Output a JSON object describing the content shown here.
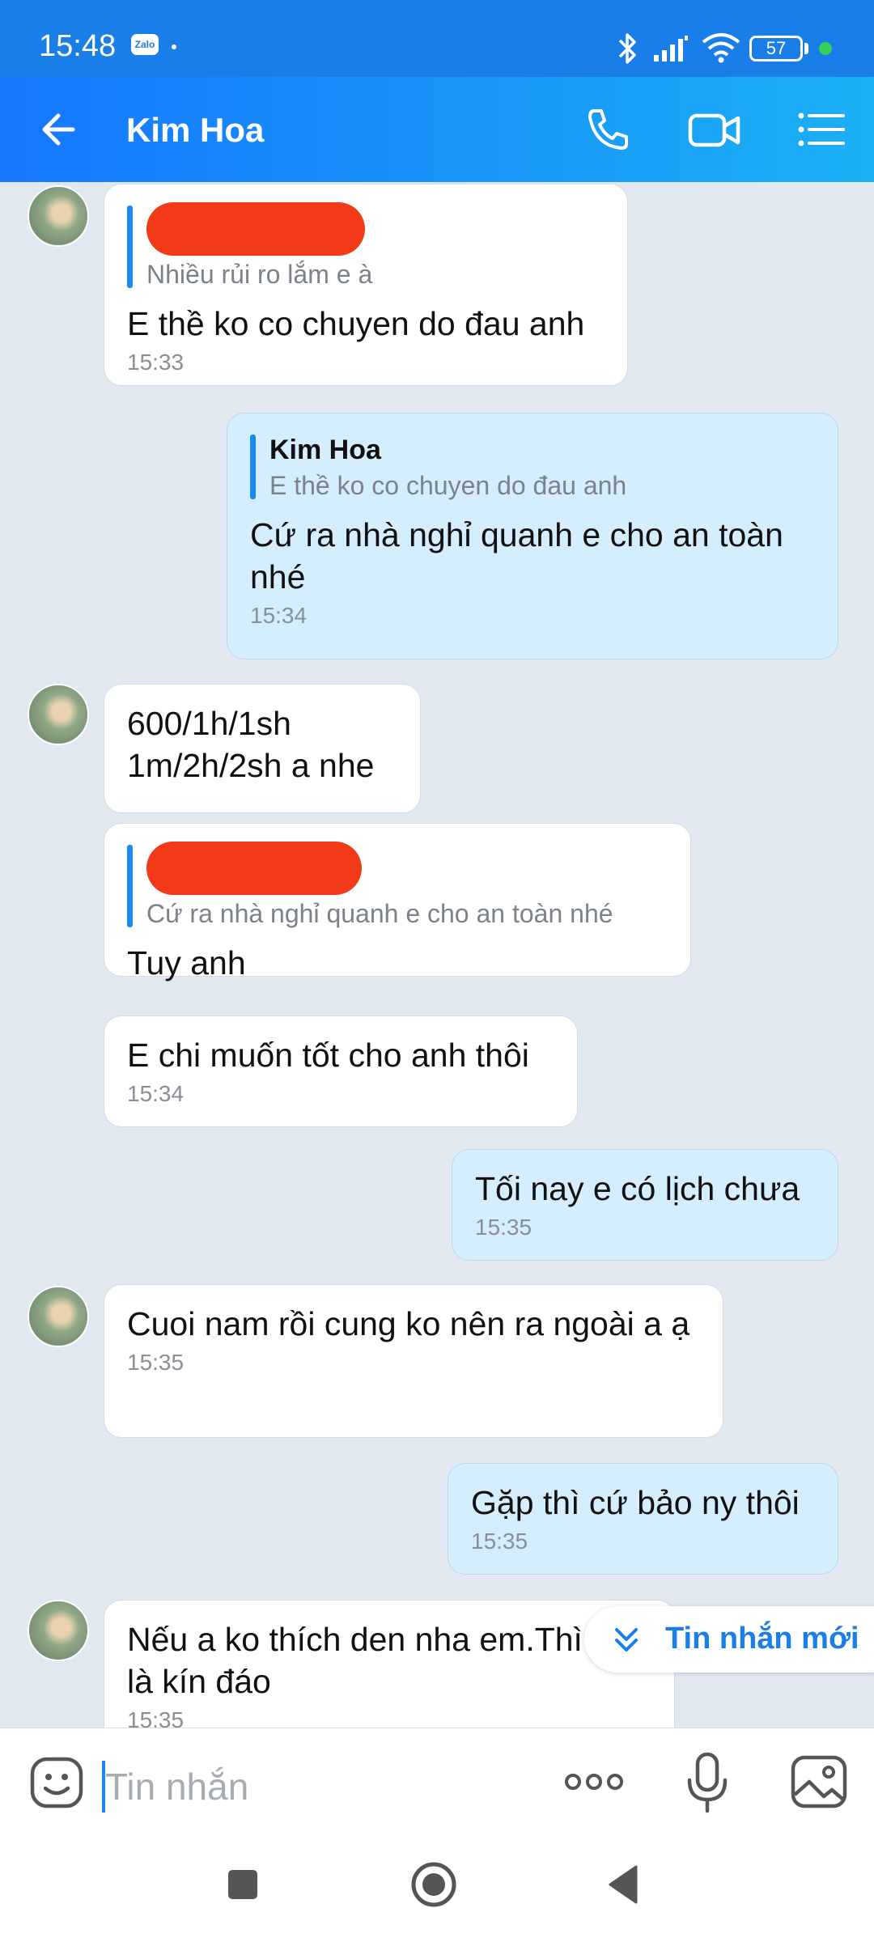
{
  "status_bar": {
    "time": "15:48",
    "app_badge": "Zalo",
    "battery": "57"
  },
  "header": {
    "contact_name": "Kim Hoa"
  },
  "messages": [
    {
      "dir": "in",
      "avatar": true,
      "quote_redacted": true,
      "quote_text": "Nhiều rủi ro lắm e à",
      "text": "E thề ko co chuyen do đau anh",
      "time": "15:33"
    },
    {
      "dir": "out",
      "quote_author": "Kim Hoa",
      "quote_text": "E thề ko co chuyen do đau anh",
      "text": "Cứ ra nhà nghỉ quanh e cho an toàn nhé",
      "time": "15:34"
    },
    {
      "dir": "in",
      "avatar": true,
      "text": "600/1h/1sh\n1m/2h/2sh a nhe"
    },
    {
      "dir": "in",
      "quote_redacted": true,
      "quote_text": "Cứ ra nhà nghỉ quanh e cho an toàn nhé",
      "text": "Tuy anh"
    },
    {
      "dir": "in",
      "text": "E chi muốn tốt cho anh thôi",
      "time": "15:34"
    },
    {
      "dir": "out",
      "text": "Tối nay e có lịch chưa",
      "time": "15:35"
    },
    {
      "dir": "in",
      "avatar": true,
      "text": "Cuoi nam rồi cung ko nên ra ngoài a ạ",
      "time": "15:35"
    },
    {
      "dir": "out",
      "text": "Gặp thì cứ bảo ny thôi",
      "time": "15:35"
    },
    {
      "dir": "in",
      "avatar": true,
      "text": "Nếu a ko thích den nha em.Thì A25 là kín đáo",
      "time": "15:35"
    }
  ],
  "new_messages_label": "Tin nhắn mới",
  "composer": {
    "placeholder": "Tin nhắn"
  }
}
